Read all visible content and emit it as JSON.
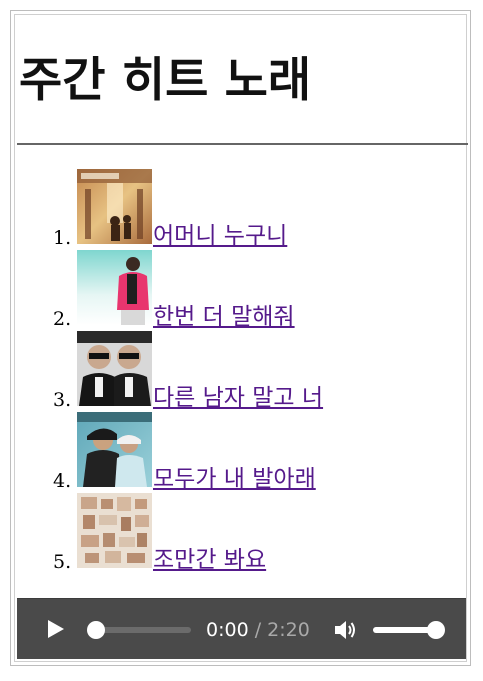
{
  "page": {
    "title": "주간 히트 노래"
  },
  "songs": [
    {
      "number": "1.",
      "title": "어머니 누구니",
      "thumb_icon": "album-cover-1"
    },
    {
      "number": "2.",
      "title": "한번 더 말해줘",
      "thumb_icon": "album-cover-2"
    },
    {
      "number": "3.",
      "title": "다른 남자 말고 너",
      "thumb_icon": "album-cover-3"
    },
    {
      "number": "4.",
      "title": "모두가 내 발아래",
      "thumb_icon": "album-cover-4"
    },
    {
      "number": "5.",
      "title": "조만간 봐요",
      "thumb_icon": "album-cover-5"
    }
  ],
  "player": {
    "current_time": "0:00",
    "separator": "/",
    "total_time": "2:20",
    "progress_fraction": 0,
    "volume_fraction": 0.92,
    "play_icon": "play-icon",
    "volume_icon": "volume-icon"
  },
  "colors": {
    "link": "#551a8b",
    "player_bg": "#4a4a4a",
    "rule": "#666666"
  }
}
